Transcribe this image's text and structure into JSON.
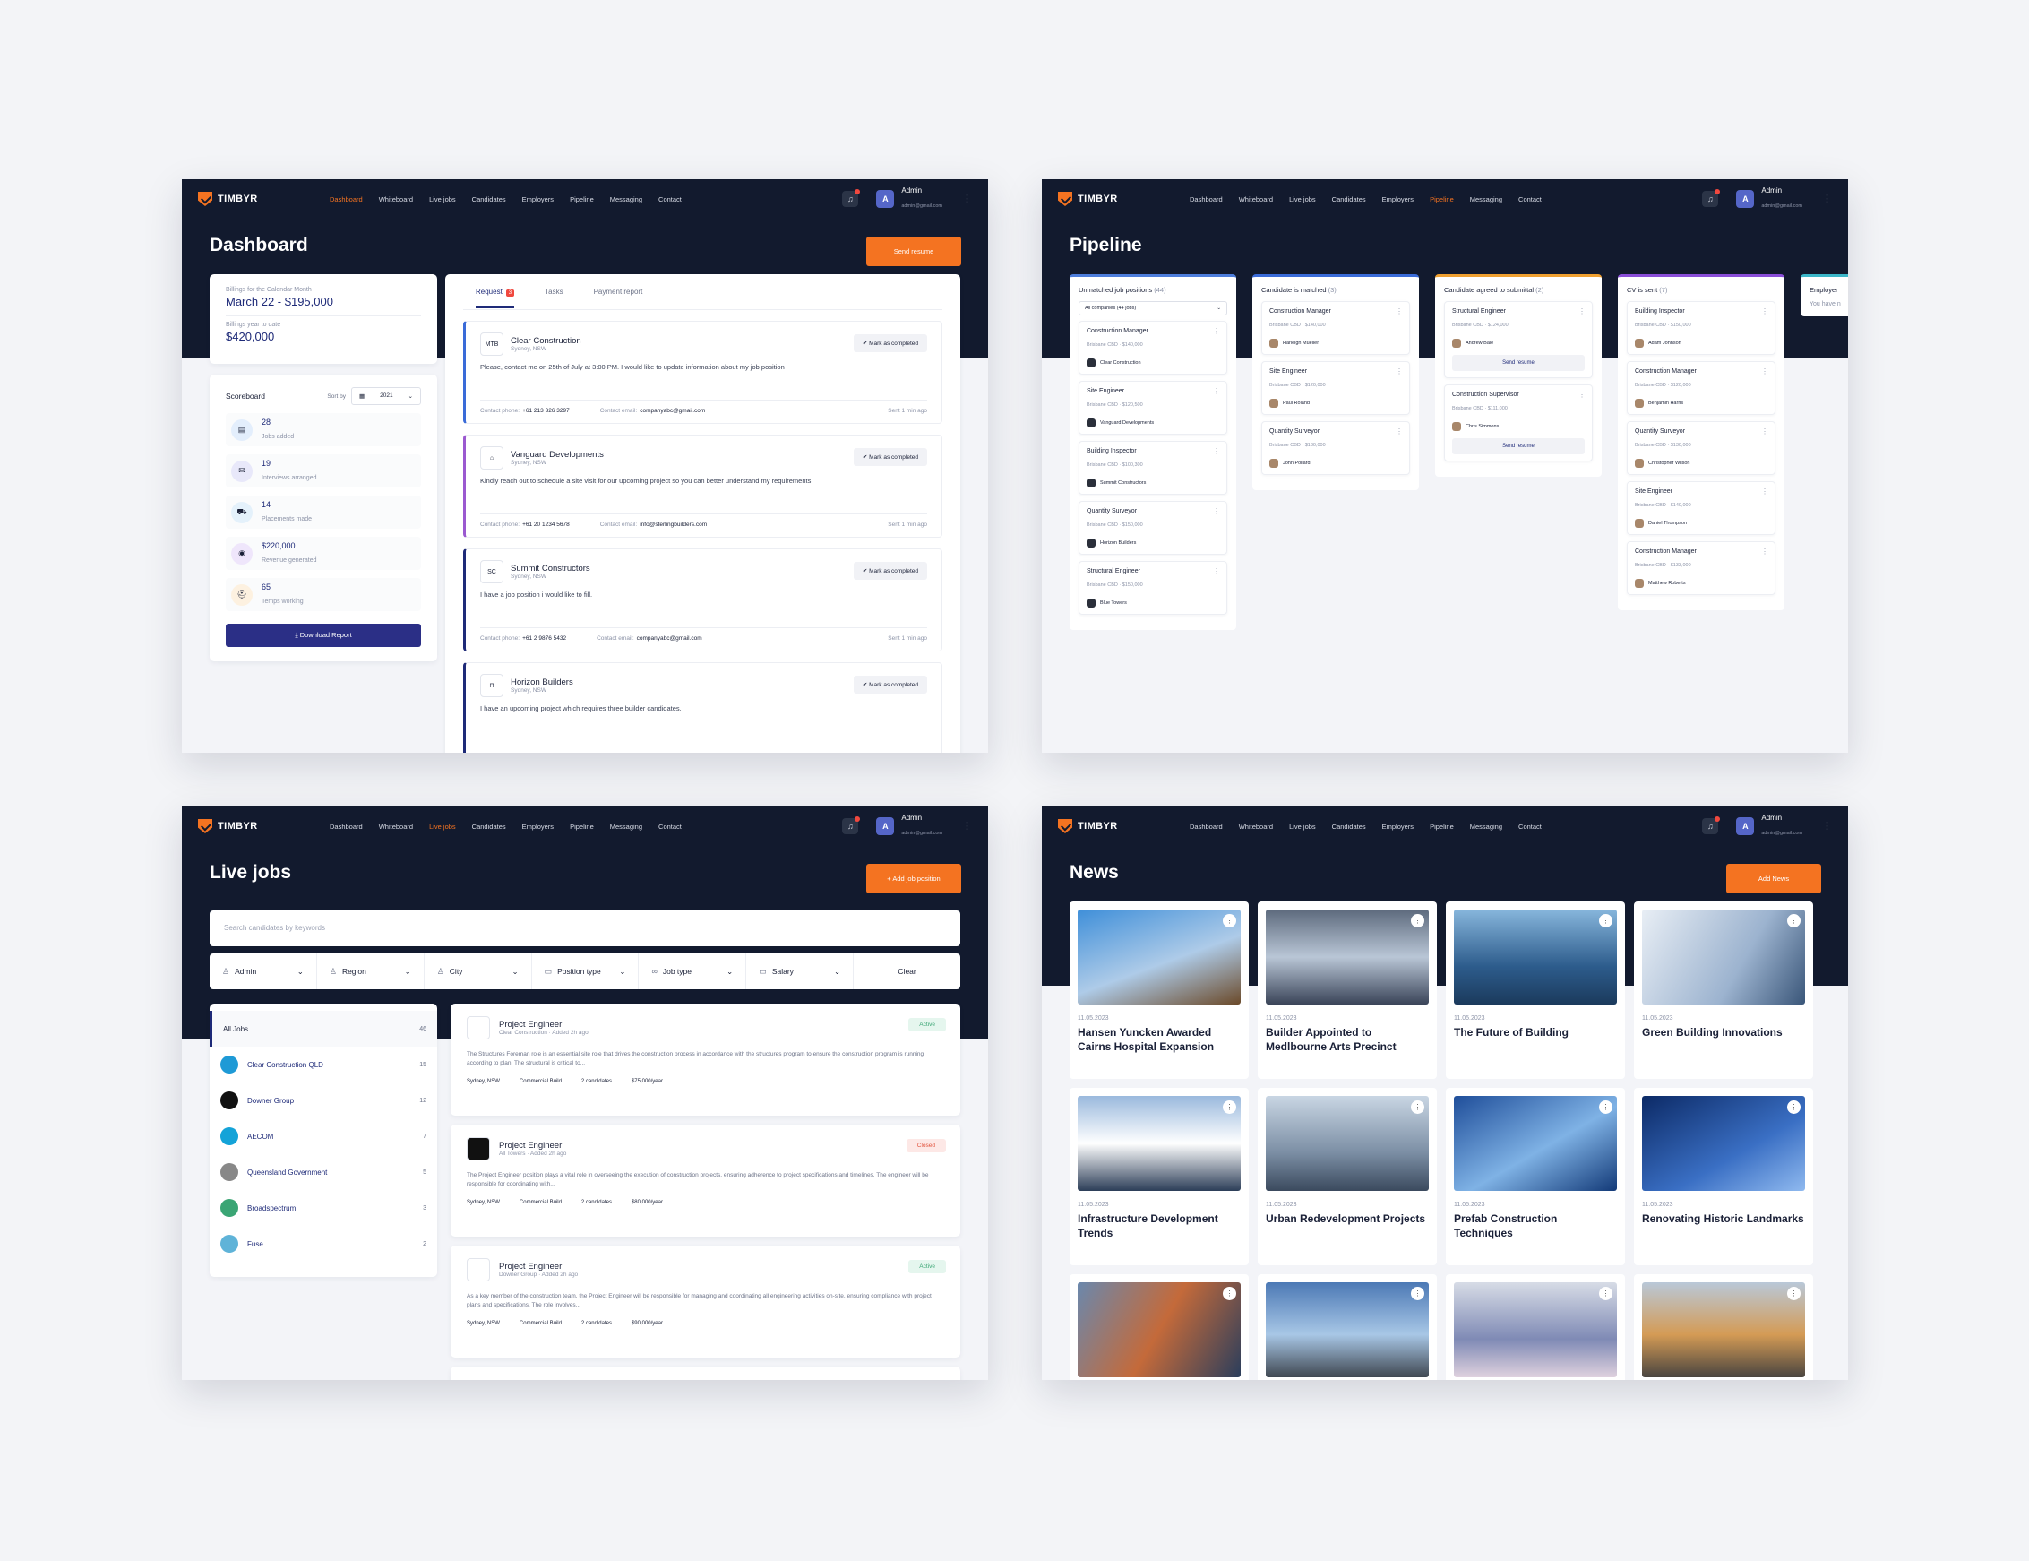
{
  "app": {
    "brand": "TIMBYR",
    "menu": [
      "Dashboard",
      "Whiteboard",
      "Live jobs",
      "Candidates",
      "Employers",
      "Pipeline",
      "Messaging",
      "Contact"
    ],
    "user": {
      "initial": "A",
      "name": "Admin",
      "email": "admin@gmail.com"
    },
    "accent": "#f47321",
    "navy": "#121a2e"
  },
  "dashboard": {
    "title": "Dashboard",
    "send_resume": "Send resume",
    "billing": {
      "month_label": "Billings for the Calendar Month",
      "month_value": "March 22 - $195,000",
      "year_label": "Billings year to date",
      "year_value": "$420,000"
    },
    "scoreboard": {
      "title": "Scoreboard",
      "sort_label": "Sort by",
      "year": "2021",
      "download": "Download Report",
      "items": [
        {
          "value": "28",
          "label": "Jobs added",
          "icon": "briefcase-icon",
          "color": "#e3eefc"
        },
        {
          "value": "19",
          "label": "Interviews arranged",
          "icon": "chat-icon",
          "color": "#e8e8fa"
        },
        {
          "value": "14",
          "label": "Placements made",
          "icon": "truck-icon",
          "color": "#e4f1fb"
        },
        {
          "value": "$220,000",
          "label": "Revenue generated",
          "icon": "coin-icon",
          "color": "#efe6fb"
        },
        {
          "value": "65",
          "label": "Temps working",
          "icon": "helmet-icon",
          "color": "#fdf1e0"
        }
      ]
    },
    "tabs": [
      "Request",
      "Tasks",
      "Payment report"
    ],
    "request_count": "3",
    "mark_label": "Mark as completed",
    "phone_label": "Contact phone:",
    "email_label": "Contact email:",
    "requests": [
      {
        "name": "Clear Construction",
        "loc": "Sydney, NSW",
        "text": "Please, contact me on 25th of July at 3:00 PM. I would like to update information about my job position",
        "phone": "+61 213 326 3297",
        "email": "companyabc@gmail.com",
        "sent": "Sent 1 min ago",
        "color": "#3a6bd8",
        "logo": "MTB"
      },
      {
        "name": "Vanguard Developments",
        "loc": "Sydney, NSW",
        "text": "Kindly reach out to schedule a site visit for our upcoming project so you can better understand my requirements.",
        "phone": "+61 20 1234 5678",
        "email": "info@sterlingbuilders.com",
        "sent": "Sent 1 min ago",
        "color": "#9b59d0",
        "logo": "⌂"
      },
      {
        "name": "Summit Constructors",
        "loc": "Sydney, NSW",
        "text": "I have a job position i would like to fill.",
        "phone": "+61 2 9876 5432",
        "email": "companyabc@gmail.com",
        "sent": "Sent 1 min ago",
        "color": "#1e2a78",
        "logo": "SC"
      },
      {
        "name": "Horizon Builders",
        "loc": "Sydney, NSW",
        "text": "I have an upcoming project which requires three builder candidates.",
        "phone": "",
        "email": "",
        "sent": "",
        "color": "#1e2a78",
        "logo": "⊓"
      }
    ]
  },
  "pipeline": {
    "title": "Pipeline",
    "send_resume": "Send resume",
    "filter": "All companies (44 jobs)",
    "columns": [
      {
        "title": "Unmatched job positions",
        "count": "(44)",
        "color": "#4d7ddb",
        "cards": [
          {
            "role": "Construction Manager",
            "meta": "Brisbane CBD · $140,000",
            "who": "Clear Construction"
          },
          {
            "role": "Site Engineer",
            "meta": "Brisbane CBD · $120,500",
            "who": "Vanguard Developments"
          },
          {
            "role": "Building Inspector",
            "meta": "Brisbane CBD · $100,300",
            "who": "Summit Constructors"
          },
          {
            "role": "Quantity Surveyor",
            "meta": "Brisbane CBD · $150,000",
            "who": "Horizon Builders"
          },
          {
            "role": "Structural Engineer",
            "meta": "Brisbane CBD · $150,000",
            "who": "Blue Towers"
          }
        ]
      },
      {
        "title": "Candidate is matched",
        "count": "(3)",
        "color": "#3a6bd8",
        "cards": [
          {
            "role": "Construction Manager",
            "meta": "Brisbane CBD · $140,000",
            "who": "Harleigh Mueller"
          },
          {
            "role": "Site Engineer",
            "meta": "Brisbane CBD · $120,000",
            "who": "Paul Roland"
          },
          {
            "role": "Quantity Surveyor",
            "meta": "Brisbane CBD · $130,000",
            "who": "John Pollard"
          }
        ]
      },
      {
        "title": "Candidate agreed to submittal",
        "count": "(2)",
        "color": "#f0a030",
        "cards": [
          {
            "role": "Structural Engineer",
            "meta": "Brisbane CBD · $124,000",
            "who": "Andrew Bale"
          },
          {
            "role": "Construction Supervisor",
            "meta": "Brisbane CBD · $111,000",
            "who": "Chris Simmons"
          }
        ]
      },
      {
        "title": "CV is sent",
        "count": "(7)",
        "color": "#8a4ed8",
        "cards": [
          {
            "role": "Building Inspector",
            "meta": "Brisbane CBD · $150,000",
            "who": "Adam Johnson"
          },
          {
            "role": "Construction Manager",
            "meta": "Brisbane CBD · $120,000",
            "who": "Benjamin Harris"
          },
          {
            "role": "Quantity Surveyor",
            "meta": "Brisbane CBD · $130,000",
            "who": "Christopher Wilson"
          },
          {
            "role": "Site Engineer",
            "meta": "Brisbane CBD · $140,000",
            "who": "Daniel Thompson"
          },
          {
            "role": "Construction Manager",
            "meta": "Brisbane CBD · $133,000",
            "who": "Matthew Roberts"
          }
        ]
      },
      {
        "title": "Employer",
        "count": "",
        "color": "#3bb6c8",
        "note": "You have n"
      }
    ]
  },
  "livejobs": {
    "title": "Live jobs",
    "add": "+ Add job position",
    "search_placeholder": "Search candidates by keywords",
    "filters": [
      "Admin",
      "Region",
      "City",
      "Position type",
      "Job type",
      "Salary"
    ],
    "clear": "Clear",
    "companies": [
      {
        "name": "All Jobs",
        "count": "46"
      },
      {
        "name": "Clear Construction QLD",
        "count": "15"
      },
      {
        "name": "Downer Group",
        "count": "12"
      },
      {
        "name": "AECOM",
        "count": "7"
      },
      {
        "name": "Queensland Government",
        "count": "5"
      },
      {
        "name": "Broadspectrum",
        "count": "3"
      },
      {
        "name": "Fuse",
        "count": "2"
      }
    ],
    "jobs": [
      {
        "title": "Project Engineer",
        "sub": "Clear Construction · Added 2h ago",
        "status": "Active",
        "text": "The Structures Foreman role is an essential site role that drives the construction process in accordance with the structures program to ensure the construction program is running according to plan. The structural is critical to...",
        "loc": "Sydney, NSW",
        "type": "Commercial Build",
        "cand": "2 candidates",
        "salary": "$75,000/year"
      },
      {
        "title": "Project Engineer",
        "sub": "All Towers · Added 2h ago",
        "status": "Closed",
        "text": "The Project Engineer position plays a vital role in overseeing the execution of construction projects, ensuring adherence to project specifications and timelines. The engineer will be responsible for coordinating with...",
        "loc": "Sydney, NSW",
        "type": "Commercial Build",
        "cand": "2 candidates",
        "salary": "$80,000/year"
      },
      {
        "title": "Project Engineer",
        "sub": "Downer Group · Added 2h ago",
        "status": "Active",
        "text": "As a key member of the construction team, the Project Engineer will be responsible for managing and coordinating all engineering activities on-site, ensuring compliance with project plans and specifications. The role involves...",
        "loc": "Sydney, NSW",
        "type": "Commercial Build",
        "cand": "2 candidates",
        "salary": "$90,000/year"
      }
    ]
  },
  "news": {
    "title": "News",
    "add": "Add News",
    "items": [
      {
        "date": "11.05.2023",
        "title": "Hansen Yuncken Awarded Cairns Hospital Expansion"
      },
      {
        "date": "11.05.2023",
        "title": "Builder Appointed to Medlbourne Arts Precinct"
      },
      {
        "date": "11.05.2023",
        "title": "The Future of Building"
      },
      {
        "date": "11.05.2023",
        "title": "Green Building Innovations"
      },
      {
        "date": "11.05.2023",
        "title": "Infrastructure Development Trends"
      },
      {
        "date": "11.05.2023",
        "title": "Urban Redevelopment Projects"
      },
      {
        "date": "11.05.2023",
        "title": "Prefab Construction Techniques"
      },
      {
        "date": "11.05.2023",
        "title": "Renovating Historic Landmarks"
      },
      {
        "date": "",
        "title": ""
      },
      {
        "date": "",
        "title": ""
      },
      {
        "date": "",
        "title": ""
      },
      {
        "date": "",
        "title": ""
      }
    ]
  }
}
